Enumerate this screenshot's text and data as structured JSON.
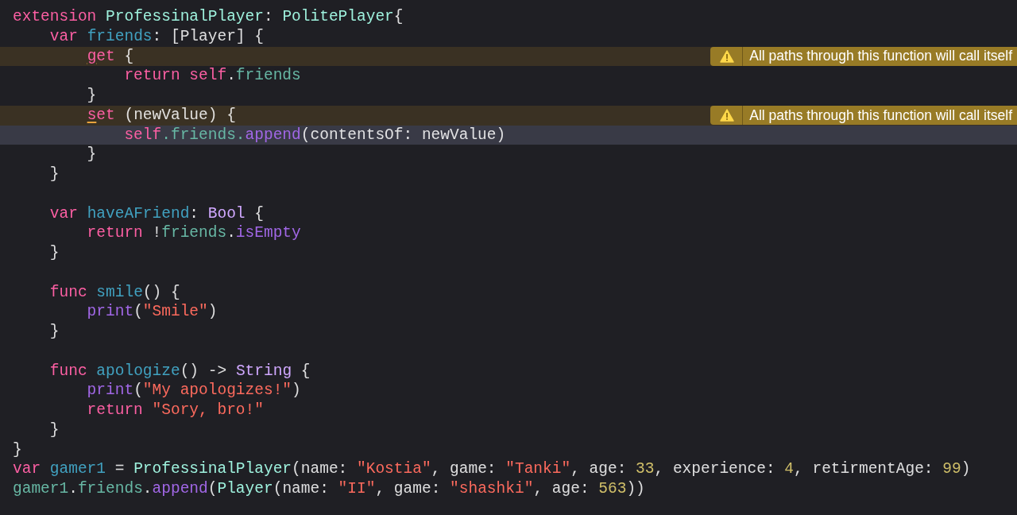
{
  "editor": {
    "lines": [
      {
        "current_line": false,
        "tokens": [
          {
            "kind": "keyword",
            "text": "extension "
          },
          {
            "kind": "project_type",
            "text": "ProfessinalPlayer"
          },
          {
            "kind": "plain",
            "text": ": "
          },
          {
            "kind": "project_type",
            "text": "PolitePlayer"
          },
          {
            "kind": "plain",
            "text": "{"
          }
        ]
      },
      {
        "current_line": false,
        "tokens": [
          {
            "kind": "keyword",
            "text": "    var "
          },
          {
            "kind": "declaration",
            "text": "friends"
          },
          {
            "kind": "plain",
            "text": ": [Player] {"
          }
        ]
      },
      {
        "current_line": false,
        "warning": "All paths through this function will call itself",
        "tokens": [
          {
            "kind": "flagged",
            "text": "        g"
          },
          {
            "kind": "keyword",
            "text": "et"
          },
          {
            "kind": "plain",
            "text": " {"
          }
        ]
      },
      {
        "current_line": false,
        "tokens": [
          {
            "kind": "keyword",
            "text": "            return self"
          },
          {
            "kind": "plain",
            "text": "."
          },
          {
            "kind": "property",
            "text": "friends"
          }
        ]
      },
      {
        "current_line": false,
        "tokens": [
          {
            "kind": "plain",
            "text": "        }"
          }
        ]
      },
      {
        "current_line": false,
        "warning": "All paths through this function will call itself",
        "tokens": [
          {
            "kind": "flagged",
            "text": "        s"
          },
          {
            "kind": "keyword",
            "text": "et"
          },
          {
            "kind": "plain",
            "text": " (newValue) {"
          }
        ]
      },
      {
        "current_line": true,
        "tokens": [
          {
            "kind": "keyword",
            "text": "            self"
          },
          {
            "kind": "property",
            "text": ".friends."
          },
          {
            "kind": "method",
            "text": "append"
          },
          {
            "kind": "plain",
            "text": "(contentsOf: newValue)"
          }
        ]
      },
      {
        "current_line": false,
        "tokens": [
          {
            "kind": "plain",
            "text": "        }"
          }
        ]
      },
      {
        "current_line": false,
        "tokens": [
          {
            "kind": "plain",
            "text": "    }"
          }
        ]
      },
      {
        "current_line": false
      },
      {
        "current_line": false,
        "tokens": [
          {
            "kind": "keyword",
            "text": "    var "
          },
          {
            "kind": "declaration",
            "text": "haveAFriend"
          },
          {
            "kind": "plain",
            "text": ": "
          },
          {
            "kind": "type",
            "text": "Bool"
          },
          {
            "kind": "plain",
            "text": " {"
          }
        ]
      },
      {
        "current_line": false,
        "tokens": [
          {
            "kind": "keyword",
            "text": "        return"
          },
          {
            "kind": "plain",
            "text": " !"
          },
          {
            "kind": "property",
            "text": "friends"
          },
          {
            "kind": "plain",
            "text": "."
          },
          {
            "kind": "method",
            "text": "isEmpty"
          }
        ]
      },
      {
        "current_line": false,
        "tokens": [
          {
            "kind": "plain",
            "text": "    }"
          }
        ]
      },
      {
        "current_line": false
      },
      {
        "current_line": false,
        "tokens": [
          {
            "kind": "keyword",
            "text": "    func "
          },
          {
            "kind": "declaration",
            "text": "smile"
          },
          {
            "kind": "plain",
            "text": "() {"
          }
        ]
      },
      {
        "current_line": false,
        "tokens": [
          {
            "kind": "method",
            "text": "        print"
          },
          {
            "kind": "plain",
            "text": "("
          },
          {
            "kind": "string",
            "text": "\"Smile\""
          },
          {
            "kind": "plain",
            "text": ")"
          }
        ]
      },
      {
        "current_line": false,
        "tokens": [
          {
            "kind": "plain",
            "text": "    }"
          }
        ]
      },
      {
        "current_line": false
      },
      {
        "current_line": false,
        "tokens": [
          {
            "kind": "keyword",
            "text": "    func "
          },
          {
            "kind": "declaration",
            "text": "apologize"
          },
          {
            "kind": "plain",
            "text": "() -> "
          },
          {
            "kind": "type",
            "text": "String"
          },
          {
            "kind": "plain",
            "text": " {"
          }
        ]
      },
      {
        "current_line": false,
        "tokens": [
          {
            "kind": "method",
            "text": "        print"
          },
          {
            "kind": "plain",
            "text": "("
          },
          {
            "kind": "string",
            "text": "\"My apologizes!\""
          },
          {
            "kind": "plain",
            "text": ")"
          }
        ]
      },
      {
        "current_line": false,
        "tokens": [
          {
            "kind": "keyword",
            "text": "        return "
          },
          {
            "kind": "string",
            "text": "\"Sory, bro!\""
          }
        ]
      },
      {
        "current_line": false,
        "tokens": [
          {
            "kind": "plain",
            "text": "    }"
          }
        ]
      },
      {
        "current_line": false,
        "tokens": [
          {
            "kind": "plain",
            "text": "}"
          }
        ]
      },
      {
        "current_line": false,
        "tokens": [
          {
            "kind": "keyword",
            "text": "var "
          },
          {
            "kind": "declaration",
            "text": "gamer1"
          },
          {
            "kind": "plain",
            "text": " = "
          },
          {
            "kind": "project_type",
            "text": "ProfessinalPlayer"
          },
          {
            "kind": "plain",
            "text": "(name: "
          },
          {
            "kind": "string",
            "text": "\"Kostia\""
          },
          {
            "kind": "plain",
            "text": ", game: "
          },
          {
            "kind": "string",
            "text": "\"Tanki\""
          },
          {
            "kind": "plain",
            "text": ", age: "
          },
          {
            "kind": "number",
            "text": "33"
          },
          {
            "kind": "plain",
            "text": ", experience: "
          },
          {
            "kind": "number",
            "text": "4"
          },
          {
            "kind": "plain",
            "text": ", retirmentAge: "
          },
          {
            "kind": "number",
            "text": "99"
          },
          {
            "kind": "plain",
            "text": ")"
          }
        ]
      },
      {
        "current_line": false,
        "tokens": [
          {
            "kind": "property",
            "text": "gamer1"
          },
          {
            "kind": "plain",
            "text": "."
          },
          {
            "kind": "property",
            "text": "friends"
          },
          {
            "kind": "plain",
            "text": "."
          },
          {
            "kind": "method",
            "text": "append"
          },
          {
            "kind": "plain",
            "text": "("
          },
          {
            "kind": "project_type",
            "text": "Player"
          },
          {
            "kind": "plain",
            "text": "(name: "
          },
          {
            "kind": "string",
            "text": "\"II\""
          },
          {
            "kind": "plain",
            "text": ", game: "
          },
          {
            "kind": "string",
            "text": "\"shashki\""
          },
          {
            "kind": "plain",
            "text": ", age: "
          },
          {
            "kind": "number",
            "text": "563"
          },
          {
            "kind": "plain",
            "text": "))"
          }
        ]
      }
    ]
  }
}
